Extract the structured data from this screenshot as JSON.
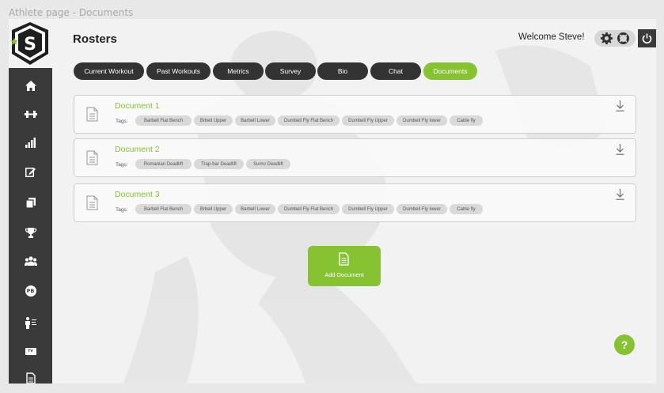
{
  "window_title": "Athlete page - Documents",
  "header": {
    "title": "Rosters",
    "welcome": "Welcome Steve!"
  },
  "tabs": [
    {
      "label": "Current Workout",
      "active": false
    },
    {
      "label": "Past Workouts",
      "active": false
    },
    {
      "label": "Metrics",
      "active": false
    },
    {
      "label": "Survey",
      "active": false
    },
    {
      "label": "Bio",
      "active": false
    },
    {
      "label": "Chat",
      "active": false
    },
    {
      "label": "Documents",
      "active": true
    }
  ],
  "sidebar": {
    "logo_letter": "S",
    "items": [
      {
        "icon": "home-icon"
      },
      {
        "icon": "dumbbell-icon"
      },
      {
        "icon": "bar-chart-icon"
      },
      {
        "icon": "edit-icon"
      },
      {
        "icon": "copy-icon"
      },
      {
        "icon": "trophy-icon"
      },
      {
        "icon": "group-icon"
      },
      {
        "icon": "pb-badge-icon",
        "text": "PB"
      },
      {
        "icon": "coach-icon"
      },
      {
        "icon": "tv-icon",
        "text": "TV"
      },
      {
        "icon": "document-icon"
      }
    ]
  },
  "documents": {
    "tags_label": "Tags:",
    "items": [
      {
        "title": "Document 1",
        "tags": [
          "Barbell Flat Bench",
          "Brbell Upper",
          "Barbell Lower",
          "Dumbell Fly Flat Bench",
          "Dumbell Fly Upper",
          "Dumbell Fly lower",
          "Cable fly"
        ]
      },
      {
        "title": "Document 2",
        "tags": [
          "Romanian Deadlift",
          "Trap-bar Deadlift",
          "Sumo Deadlift"
        ]
      },
      {
        "title": "Document 3",
        "tags": [
          "Barbell Flat Bench",
          "Brbell Upper",
          "Barbell Lower",
          "Dumbell Fly Flat Bench",
          "Dumbell Fly Upper",
          "Dumbell Fly lower",
          "Cable fly"
        ]
      }
    ]
  },
  "add_document_label": "Add Document",
  "help_label": "?",
  "colors": {
    "accent": "#86c232",
    "sidebar": "#3a3a3a",
    "tab": "#333333"
  }
}
